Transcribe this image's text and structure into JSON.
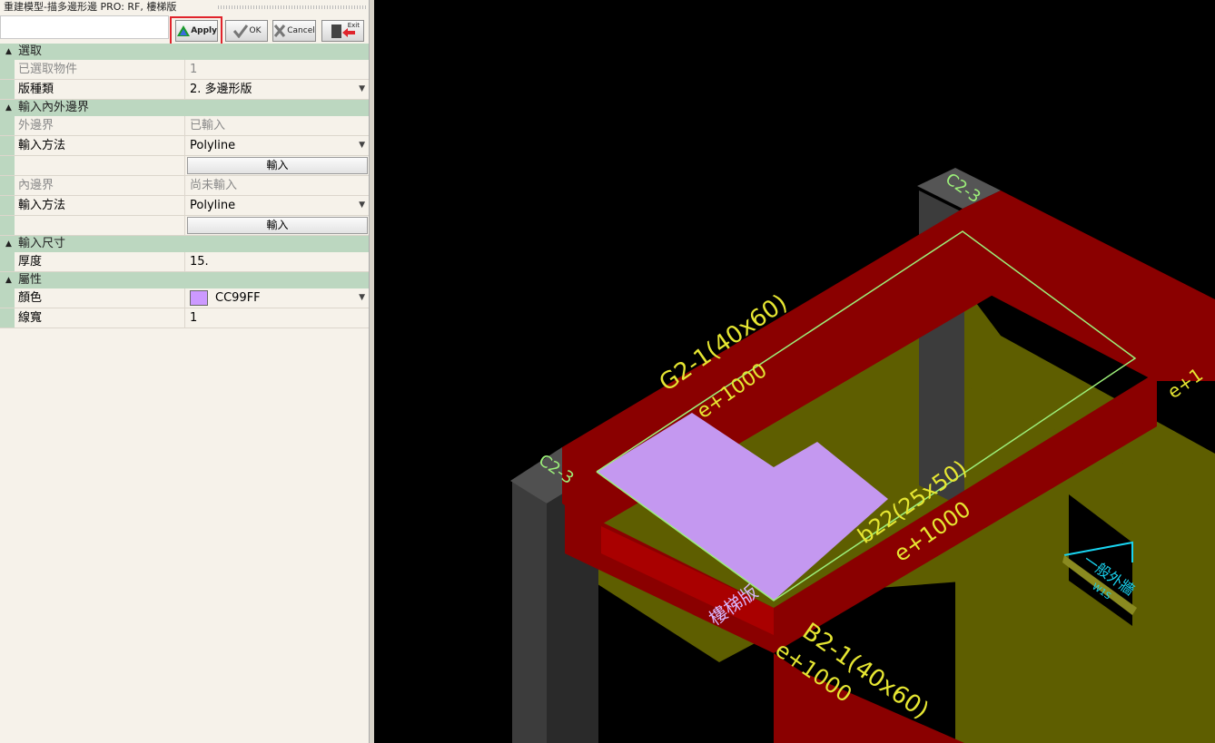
{
  "window": {
    "title": "重建模型-描多邊形邊 PRO: RF, 樓梯版"
  },
  "toolbar": {
    "apply_label": "Apply",
    "ok_label": "OK",
    "cancel_label": "Cancel",
    "exit_label": "Exit",
    "highlight_color": "#e0242c"
  },
  "grid": {
    "cat_select": "選取",
    "selected_count_label": "已選取物件",
    "selected_count_value": "1",
    "slab_type_label": "版種類",
    "slab_type_value": "2. 多邊形版",
    "cat_boundary": "輸入內外邊界",
    "outer_label": "外邊界",
    "outer_value": "已輸入",
    "outer_method_label": "輸入方法",
    "outer_method_value": "Polyline",
    "outer_input_button": "輸入",
    "inner_label": "內邊界",
    "inner_value": "尚未輸入",
    "inner_method_label": "輸入方法",
    "inner_method_value": "Polyline",
    "inner_input_button": "輸入",
    "cat_size": "輸入尺寸",
    "thickness_label": "厚度",
    "thickness_value": "15.",
    "cat_attr": "屬性",
    "color_label": "顏色",
    "color_value": "CC99FF",
    "color_hex": "#CC99FF",
    "linewidth_label": "線寬",
    "linewidth_value": "1"
  },
  "viewport": {
    "beam_top": "G2-1(40x60)",
    "beam_top_sub": "e+1000",
    "beam_mid": "b22(25x50)",
    "beam_mid_sub": "e+1000",
    "beam_bottom": "B2-1(40x60)",
    "beam_bottom_sub": "e+1000",
    "col_left": "C2-3",
    "col_right": "C2-3",
    "slab_label": "樓梯版",
    "slab_label2": "樓梯版",
    "wall_label": "一般外牆",
    "wall_sub": "W1S",
    "beam_right_sub": "e+1",
    "colors": {
      "beam": "#8a0000",
      "wall": "#5e5e00",
      "slab": "#c498f0",
      "text": "#e6e632",
      "column": "#3c3c3c"
    }
  }
}
